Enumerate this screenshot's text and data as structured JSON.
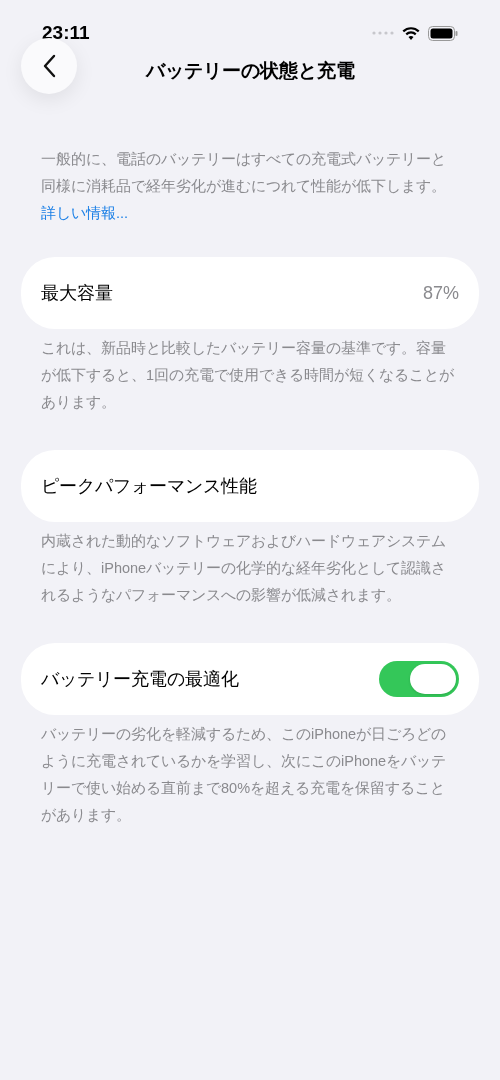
{
  "status_bar": {
    "time": "23:11"
  },
  "nav": {
    "title": "バッテリーの状態と充電"
  },
  "intro": {
    "text": "一般的に、電話のバッテリーはすべての充電式バッテリーと同様に消耗品で経年劣化が進むにつれて性能が低下します。",
    "link": "詳しい情報..."
  },
  "sections": [
    {
      "kind": "value",
      "label": "最大容量",
      "value": "87%",
      "footer": "これは、新品時と比較したバッテリー容量の基準です。容量が低下すると、1回の充電で使用できる時間が短くなることがあります。"
    },
    {
      "kind": "plain",
      "label": "ピークパフォーマンス性能",
      "footer": "内蔵された動的なソフトウェアおよびハードウェアシステムにより、iPhoneバッテリーの化学的な経年劣化として認識されるようなパフォーマンスへの影響が低減されます。"
    },
    {
      "kind": "toggle",
      "label": "バッテリー充電の最適化",
      "on": true,
      "footer": "バッテリーの劣化を軽減するため、このiPhoneが日ごろどのように充電されているかを学習し、次にこのiPhoneをバッテリーで使い始める直前まで80%を超える充電を保留することがあります。"
    }
  ]
}
